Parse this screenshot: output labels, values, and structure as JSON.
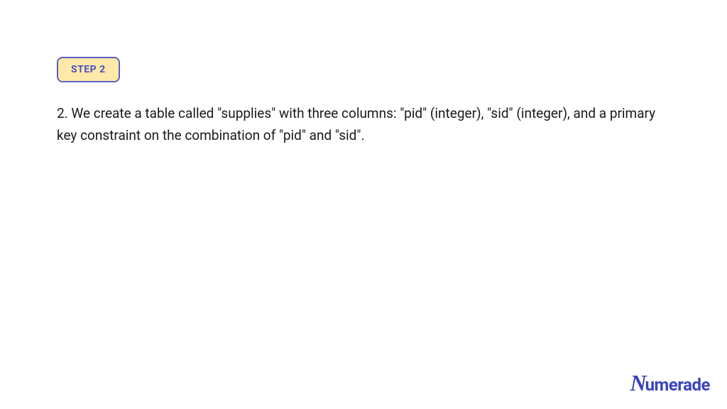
{
  "step": {
    "label": "STEP 2"
  },
  "body": {
    "text": "2. We create a table called \"supplies\" with three columns: \"pid\" (integer), \"sid\" (integer), and a primary key constraint on the combination of \"pid\" and \"sid\"."
  },
  "logo": {
    "script": "N",
    "text": "umerade"
  }
}
